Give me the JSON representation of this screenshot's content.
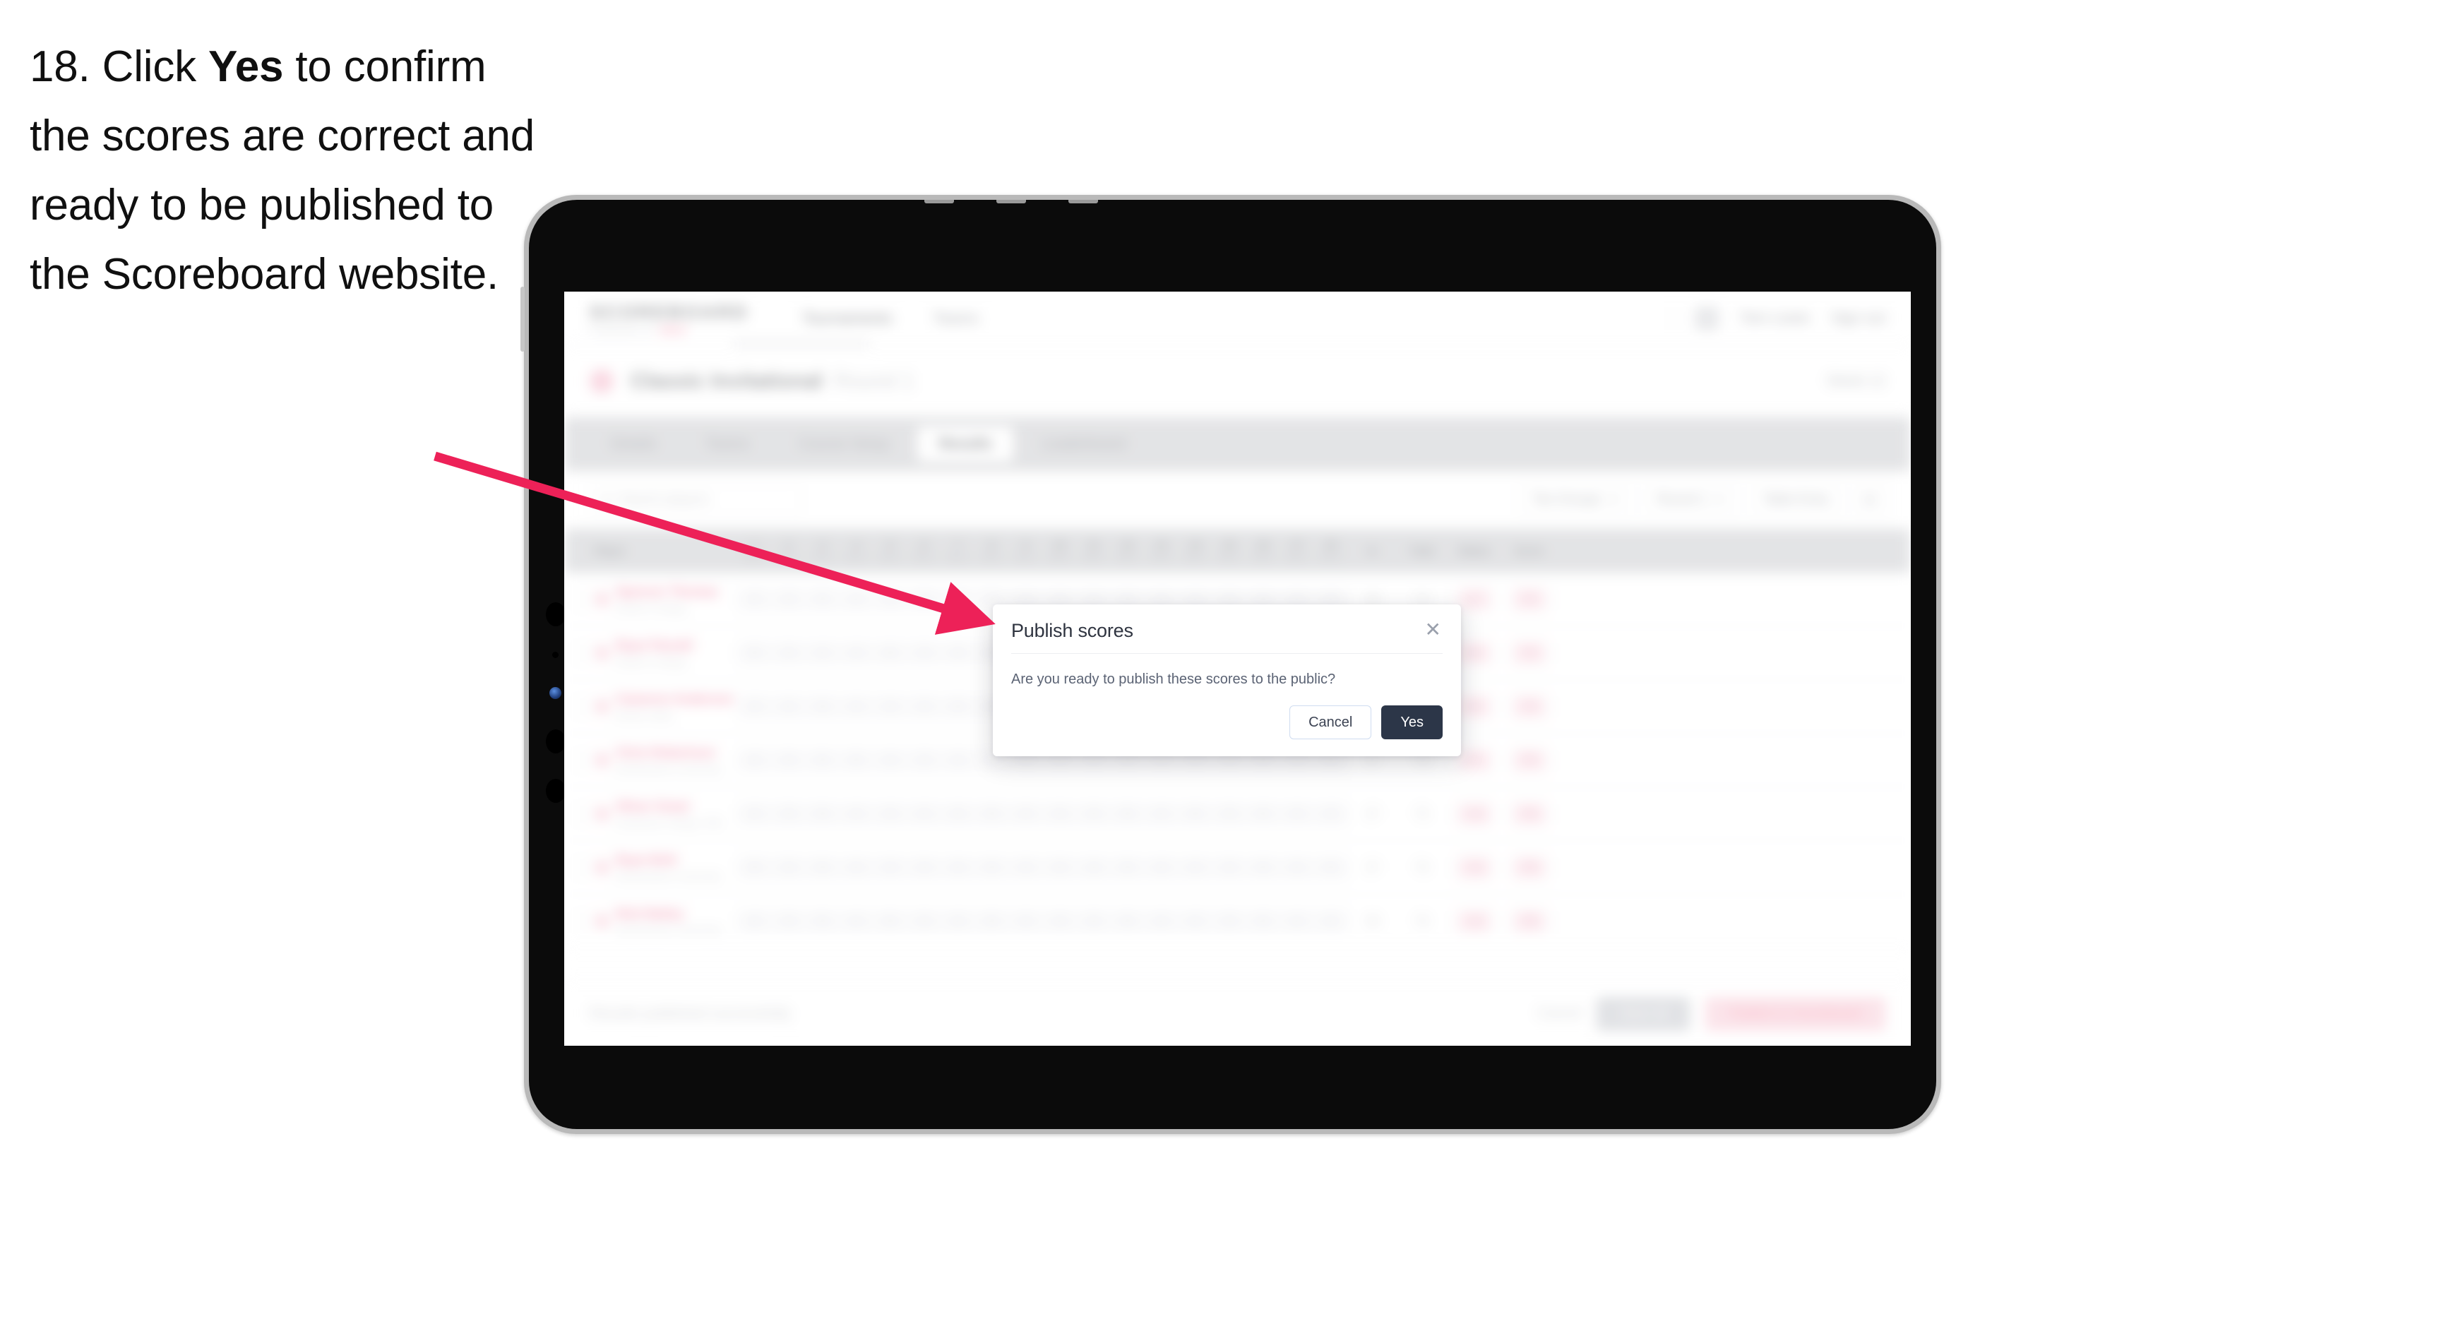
{
  "instruction": {
    "number": "18.",
    "lead": "Click",
    "emphasis": "Yes",
    "rest": "to confirm the scores are correct and ready to be published to the Scoreboard website."
  },
  "colors": {
    "arrow": "#ED2158",
    "accent_pink": "#EF3A6A",
    "dialog_primary": "#2C3648",
    "device_frame": "#B9B9B9",
    "screen_black": "#0B0B0B"
  },
  "app": {
    "brand": {
      "name": "SCOREBOARD",
      "sub_prefix": "POWERED BY",
      "sub_accent": "GOLF"
    },
    "topnav": [
      {
        "label": "Tournaments"
      },
      {
        "label": "Teams"
      }
    ],
    "topbar": {
      "user": "Tom Lewis",
      "signout": "Sign out",
      "avatar_icon": "user-avatar-icon"
    },
    "tournament": {
      "icon": "tournament-badge-icon",
      "title": "Classic Invitational",
      "subtitle": "Round 1",
      "right_label": "Week 12"
    },
    "tabs": [
      {
        "label": "Details",
        "active": false
      },
      {
        "label": "Teams",
        "active": false
      },
      {
        "label": "Course Setup",
        "active": false
      },
      {
        "label": "Results",
        "active": true
      },
      {
        "label": "Leaderboard",
        "active": false
      }
    ],
    "toolbar": {
      "search_placeholder": "Search players",
      "search_icon": "search-icon",
      "filters": [
        {
          "label": "Tee Groups"
        },
        {
          "label": "Round 1"
        }
      ],
      "sort_label": "Table Entry",
      "settings_icon": "gear-icon"
    },
    "table": {
      "player_header": "Player",
      "holes": [
        {
          "num": "1",
          "par": "Par 4"
        },
        {
          "num": "2",
          "par": "Par 3"
        },
        {
          "num": "3",
          "par": "Par 5"
        },
        {
          "num": "4",
          "par": "Par 4"
        },
        {
          "num": "5",
          "par": "Par 4"
        },
        {
          "num": "6",
          "par": "Par 3"
        },
        {
          "num": "7",
          "par": "Par 4"
        },
        {
          "num": "8",
          "par": "Par 5"
        },
        {
          "num": "9",
          "par": "Par 4"
        },
        {
          "num": "10",
          "par": "Par 4"
        },
        {
          "num": "11",
          "par": "Par 3"
        },
        {
          "num": "12",
          "par": "Par 5"
        },
        {
          "num": "13",
          "par": "Par 4"
        },
        {
          "num": "14",
          "par": "Par 4"
        },
        {
          "num": "15",
          "par": "Par 3"
        },
        {
          "num": "16",
          "par": "Par 5"
        },
        {
          "num": "17",
          "par": "Par 4"
        },
        {
          "num": "18",
          "par": "Par 4"
        }
      ],
      "summary_headers": [
        {
          "label": "In",
          "sub": ""
        },
        {
          "label": "Total",
          "sub": ""
        },
        {
          "label": "Status",
          "sub": "Score"
        }
      ],
      "rows": [
        {
          "player": "Spencer Thomas",
          "team": "Eastern College",
          "scores": [
            "4",
            "3",
            "5",
            "4",
            "4",
            "3",
            "4",
            "5",
            "4",
            "4",
            "3",
            "5",
            "4",
            "4",
            "3",
            "5",
            "4",
            "4"
          ],
          "in": "36",
          "total": "72",
          "status": "E",
          "score": "72"
        },
        {
          "player": "Ryan Parnell",
          "team": "Eastern College",
          "scores": [
            "5",
            "3",
            "4",
            "4",
            "5",
            "3",
            "4",
            "5",
            "4",
            "4",
            "3",
            "5",
            "4",
            "4",
            "3",
            "5",
            "5",
            "4"
          ],
          "in": "36",
          "total": "74",
          "status": "+2",
          "score": "74"
        },
        {
          "player": "Cameron Anderson",
          "team": "Boston State",
          "scores": [
            "4",
            "4",
            "5",
            "4",
            "4",
            "3",
            "5",
            "5",
            "4",
            "4",
            "3",
            "5",
            "4",
            "4",
            "3",
            "5",
            "4",
            "4"
          ],
          "in": "36",
          "total": "74",
          "status": "+2",
          "score": "74"
        },
        {
          "player": "Chris Robertson",
          "team": "Northwestern University",
          "scores": [
            "4",
            "3",
            "5",
            "5",
            "4",
            "3",
            "4",
            "5",
            "4",
            "4",
            "3",
            "5",
            "4",
            "4",
            "3",
            "5",
            "4",
            "5"
          ],
          "in": "37",
          "total": "75",
          "status": "+3",
          "score": "75"
        },
        {
          "player": "Oliver Grant",
          "team": "Southwest College, Hills",
          "scores": [
            "4",
            "3",
            "5",
            "4",
            "4",
            "4",
            "4",
            "5",
            "4",
            "4",
            "3",
            "5",
            "4",
            "5",
            "3",
            "5",
            "4",
            "4"
          ],
          "in": "37",
          "total": "75",
          "status": "+3",
          "score": "75"
        },
        {
          "player": "Ryan Britt",
          "team": "Northwestern University",
          "scores": [
            "5",
            "3",
            "5",
            "4",
            "4",
            "3",
            "4",
            "5",
            "4",
            "4",
            "3",
            "5",
            "4",
            "4",
            "3",
            "5",
            "4",
            "5"
          ],
          "in": "37",
          "total": "76",
          "status": "+4",
          "score": "76"
        },
        {
          "player": "Nick Bailey",
          "team": "Northwestern University",
          "scores": [
            "4",
            "3",
            "5",
            "4",
            "5",
            "3",
            "4",
            "5",
            "4",
            "4",
            "3",
            "5",
            "4",
            "4",
            "3",
            "5",
            "4",
            "4"
          ],
          "in": "36",
          "total": "76",
          "status": "+4",
          "score": "76"
        }
      ]
    },
    "bottombar": {
      "status": "Results published successfully",
      "link": "Cancel",
      "secondary_button": "Save all",
      "primary_button": "Publish to Scoreboard"
    }
  },
  "dialog": {
    "title": "Publish scores",
    "close_icon": "close-icon",
    "body": "Are you ready to publish these scores to the public?",
    "cancel_label": "Cancel",
    "confirm_label": "Yes"
  }
}
